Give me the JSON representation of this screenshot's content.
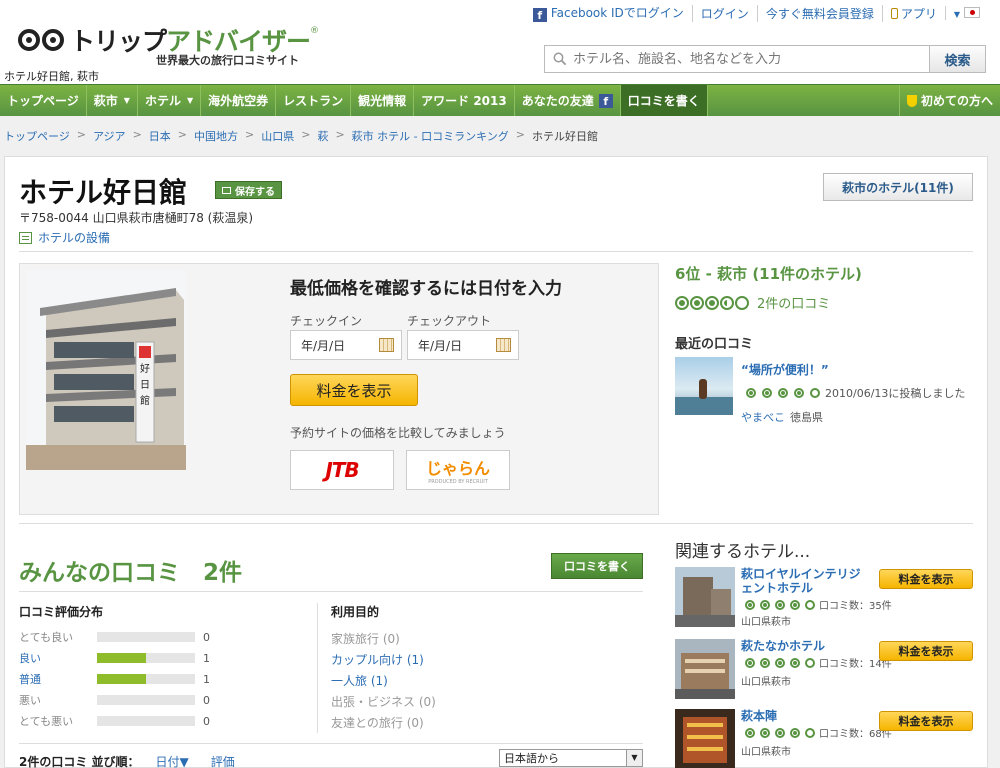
{
  "header": {
    "logo_part1": "トリップ",
    "logo_part2": "アドバイザー",
    "registered": "®",
    "tagline": "世界最大の旅行口コミサイト",
    "location_caption": "ホテル好日館, 萩市",
    "links": [
      {
        "label": "Facebook IDでログイン"
      },
      {
        "label": "ログイン"
      },
      {
        "label": "今すぐ無料会員登録"
      },
      {
        "label": "アプリ"
      }
    ],
    "fb_glyph": "f",
    "search_placeholder": "ホテル名、施設名、地名などを入力",
    "search_button": "検索"
  },
  "nav": {
    "items": [
      {
        "label": "トップページ",
        "dropdown": false
      },
      {
        "label": "萩市",
        "dropdown": true
      },
      {
        "label": "ホテル",
        "dropdown": true
      },
      {
        "label": "海外航空券",
        "dropdown": false
      },
      {
        "label": "レストラン",
        "dropdown": false
      },
      {
        "label": "観光情報",
        "dropdown": false
      },
      {
        "label": "アワード 2013",
        "dropdown": false
      },
      {
        "label": "あなたの友達",
        "dropdown": false
      },
      {
        "label": "口コミを書く",
        "dropdown": false
      }
    ],
    "caret": "▼",
    "beginner": "初めての方へ"
  },
  "breadcrumb": {
    "items": [
      "トップページ",
      "アジア",
      "日本",
      "中国地方",
      "山口県",
      "萩",
      "萩市 ホテル - 口コミランキング"
    ],
    "current": "ホテル好日館",
    "sep": ">"
  },
  "hotel": {
    "title": "ホテル好日館",
    "save": "保存する",
    "address": "〒758-0044 山口県萩市唐樋町78 (萩温泉)",
    "amenities": "ホテルの設備",
    "all_hotels": "萩市のホテル(11件)",
    "sign_text": "好日館"
  },
  "booking": {
    "title": "最低価格を確認するには日付を入力",
    "checkin_label": "チェックイン",
    "checkout_label": "チェックアウト",
    "checkin_value": "年/月/日",
    "checkout_value": "年/月/日",
    "show_price": "料金を表示",
    "compare_text": "予約サイトの価格を比較してみましょう",
    "partner_jtb": "JTB",
    "partner_jalan": "じゃらん",
    "partner_jalan_sub": "PRODUCED BY RECRUIT"
  },
  "ranking": {
    "rank_text": "6位 - 萩市 (11件のホテル)",
    "rating": 3.5,
    "review_count_link": "2件の口コミ"
  },
  "recent": {
    "title": "最近の口コミ",
    "quote": "“場所が便利！”",
    "rating": 4,
    "posted": "2010/06/13に投稿しました",
    "user": "やまべこ",
    "user_location": "徳島県"
  },
  "reviews": {
    "title": "みんなの口コミ　2件",
    "write_button": "口コミを書く",
    "distribution_title": "口コミ評価分布",
    "distribution": [
      {
        "label": "とても良い",
        "count": "0",
        "fraction": 0,
        "active": false
      },
      {
        "label": "良い",
        "count": "1",
        "fraction": 0.5,
        "active": true
      },
      {
        "label": "普通",
        "count": "1",
        "fraction": 0.5,
        "active": true
      },
      {
        "label": "悪い",
        "count": "0",
        "fraction": 0,
        "active": false
      },
      {
        "label": "とても悪い",
        "count": "0",
        "fraction": 0,
        "active": false
      }
    ],
    "purpose_title": "利用目的",
    "purposes": [
      {
        "label": "家族旅行 (0)",
        "active": false
      },
      {
        "label": "カップル向け (1)",
        "active": true
      },
      {
        "label": "一人旅 (1)",
        "active": true
      },
      {
        "label": "出張・ビジネス (0)",
        "active": false
      },
      {
        "label": "友達との旅行 (0)",
        "active": false
      }
    ],
    "sort_label": "2件の口コミ 並び順：",
    "sort_date": "日付▼",
    "sort_rating": "評価",
    "language": "日本語から"
  },
  "related": {
    "title": "関連するホテル...",
    "hotels": [
      {
        "name": "萩ロイヤルインテリジェントホテル",
        "reviews": "口コミ数：35件",
        "place": "山口県萩市",
        "rating": 4,
        "button": "料金を表示"
      },
      {
        "name": "萩たなかホテル",
        "reviews": "口コミ数：14件",
        "place": "山口県萩市",
        "rating": 4,
        "button": "料金を表示"
      },
      {
        "name": "萩本陣",
        "reviews": "口コミ数：68件",
        "place": "山口県萩市",
        "rating": 4,
        "button": "料金を表示"
      }
    ]
  }
}
